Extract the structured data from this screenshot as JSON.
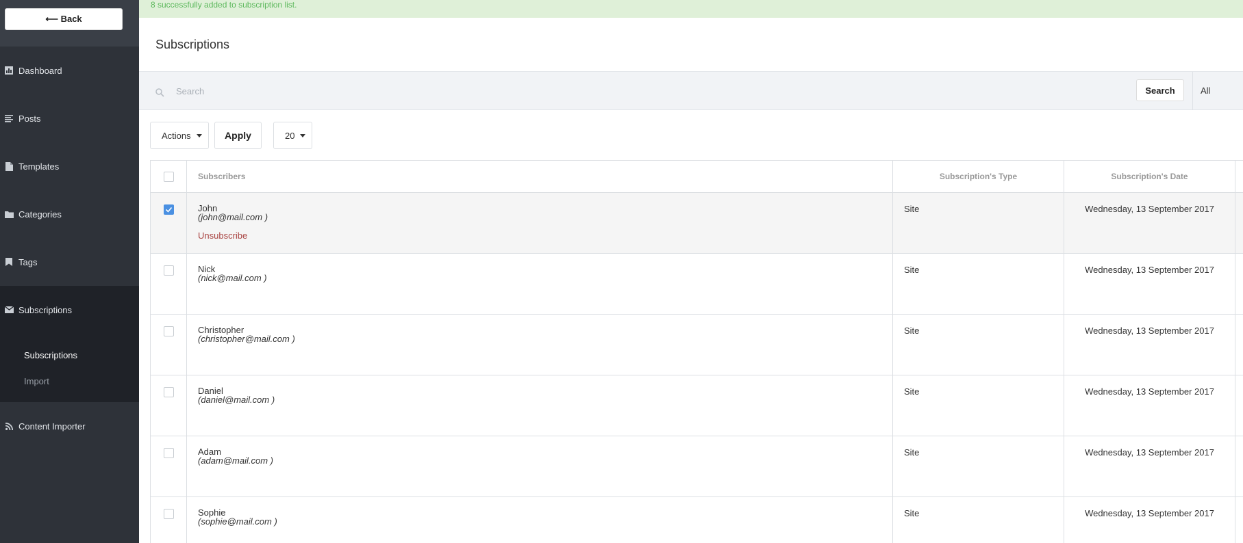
{
  "sidebar": {
    "back_label": "⟵ Back",
    "items": [
      {
        "label": "Dashboard",
        "icon": "chart-icon"
      },
      {
        "label": "Posts",
        "icon": "list-icon"
      },
      {
        "label": "Templates",
        "icon": "document-icon"
      },
      {
        "label": "Categories",
        "icon": "folder-icon"
      },
      {
        "label": "Tags",
        "icon": "bookmark-icon"
      },
      {
        "label": "Subscriptions",
        "icon": "envelope-icon"
      },
      {
        "label": "Content Importer",
        "icon": "rss-icon"
      }
    ],
    "sub_items": [
      "Subscriptions",
      "Import"
    ]
  },
  "alert": {
    "message": "8 successfully added to subscription list."
  },
  "header": {
    "title": "Subscriptions"
  },
  "search": {
    "placeholder": "Search",
    "button_label": "Search",
    "filter_label": "All"
  },
  "toolbar": {
    "actions_label": "Actions",
    "apply_label": "Apply",
    "per_page": "20"
  },
  "table": {
    "columns": [
      "Subscribers",
      "Subscription's Type",
      "Subscription's Date"
    ],
    "unsubscribe_label": "Unsubscribe",
    "rows": [
      {
        "name": "John",
        "email": "(john@mail.com )",
        "type": "Site",
        "date": "Wednesday, 13 September 2017",
        "checked": true
      },
      {
        "name": "Nick",
        "email": "(nick@mail.com )",
        "type": "Site",
        "date": "Wednesday, 13 September 2017",
        "checked": false
      },
      {
        "name": "Christopher",
        "email": "(christopher@mail.com )",
        "type": "Site",
        "date": "Wednesday, 13 September 2017",
        "checked": false
      },
      {
        "name": "Daniel",
        "email": "(daniel@mail.com )",
        "type": "Site",
        "date": "Wednesday, 13 September 2017",
        "checked": false
      },
      {
        "name": "Adam",
        "email": "(adam@mail.com )",
        "type": "Site",
        "date": "Wednesday, 13 September 2017",
        "checked": false
      },
      {
        "name": "Sophie",
        "email": "(sophie@mail.com )",
        "type": "Site",
        "date": "Wednesday, 13 September 2017",
        "checked": false
      }
    ]
  },
  "colors": {
    "sidebar_bg": "#2e3239",
    "alert_bg": "#dff0d8",
    "alert_text": "#5cb85c",
    "checkbox_checked": "#4a90e2",
    "unsubscribe": "#a94442"
  }
}
